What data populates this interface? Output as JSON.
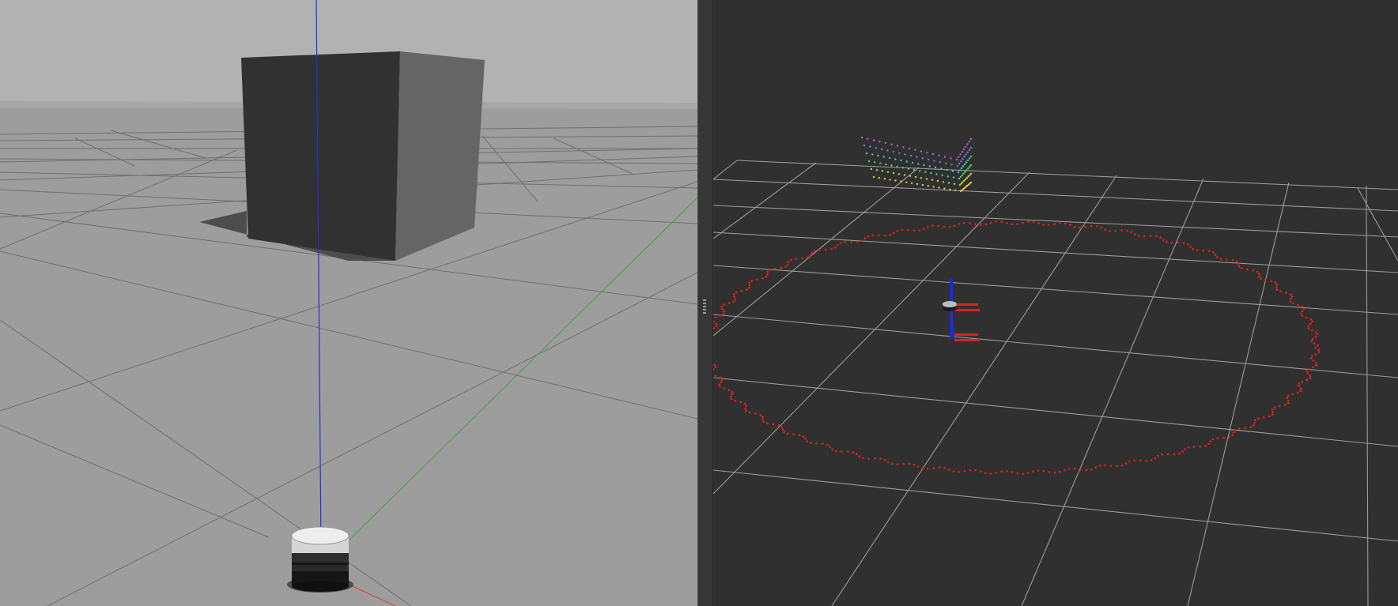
{
  "app": {
    "title": ""
  },
  "colors": {
    "gazebo_sky": "#b2b2b2",
    "gazebo_ground": "#9d9d9d",
    "gazebo_grid": "#6f6f6f",
    "box_front": "#313131",
    "box_side": "#656565",
    "axis_x": "#e23a3a",
    "axis_y": "#4fa24f",
    "axis_z": "#2a2ae0",
    "rviz_background": "#303030",
    "rviz_grid": "#a0a0a0",
    "laser_scan": "#e52020"
  },
  "gazebo_view": {
    "objects": [
      "unit-box",
      "lidar-sensor-model",
      "axis-z-line",
      "axis-y-line",
      "axis-x-line"
    ]
  },
  "splitter": {
    "handle_icon": "splitter-grip-icon"
  },
  "rviz_view": {
    "displays": [
      "grid",
      "laser-scan-ring",
      "depth-point-cloud",
      "robot-tf-frames"
    ],
    "point_cloud_colors": [
      "#b060d0",
      "#6a80e0",
      "#40c8c0",
      "#60d070",
      "#b8d840",
      "#e8c840"
    ]
  }
}
